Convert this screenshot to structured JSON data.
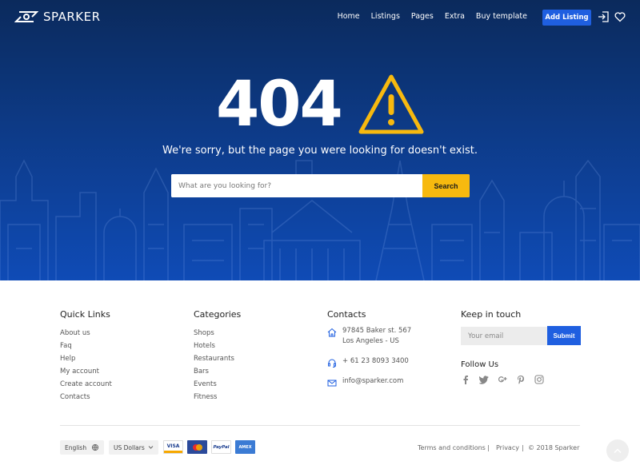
{
  "brand": {
    "name": "SPARKER"
  },
  "nav": {
    "items": [
      "Home",
      "Listings",
      "Pages",
      "Extra",
      "Buy template"
    ],
    "add_listing": "Add Listing"
  },
  "hero": {
    "code": "404",
    "message": "We're sorry, but the page you were looking for doesn't exist.",
    "search_placeholder": "What are you looking for?",
    "search_button": "Search"
  },
  "footer": {
    "quick_links": {
      "title": "Quick Links",
      "items": [
        "About us",
        "Faq",
        "Help",
        "My account",
        "Create account",
        "Contacts"
      ]
    },
    "categories": {
      "title": "Categories",
      "items": [
        "Shops",
        "Hotels",
        "Restaurants",
        "Bars",
        "Events",
        "Fitness"
      ]
    },
    "contacts": {
      "title": "Contacts",
      "address_line1": "97845 Baker st. 567",
      "address_line2": "Los Angeles - US",
      "phone": "+ 61 23 8093 3400",
      "email": "info@sparker.com"
    },
    "keep_in_touch": {
      "title": "Keep in touch",
      "email_placeholder": "Your email",
      "submit": "Submit",
      "follow_title": "Follow Us",
      "socials": [
        "facebook-icon",
        "twitter-icon",
        "google-plus-icon",
        "pinterest-icon",
        "instagram-icon"
      ]
    },
    "bottom": {
      "language": "English",
      "currency": "US Dollars",
      "payments": [
        "VISA",
        "mastercard",
        "PayPal",
        "AMEX"
      ],
      "terms": "Terms and conditions",
      "privacy": "Privacy",
      "copyright": "© 2018 Sparker",
      "separator": "|"
    }
  },
  "colors": {
    "accent": "#1f5fe0",
    "warning": "#f7b90f",
    "hero_top": "#0b2a5c",
    "hero_bottom": "#0f4bb6"
  }
}
